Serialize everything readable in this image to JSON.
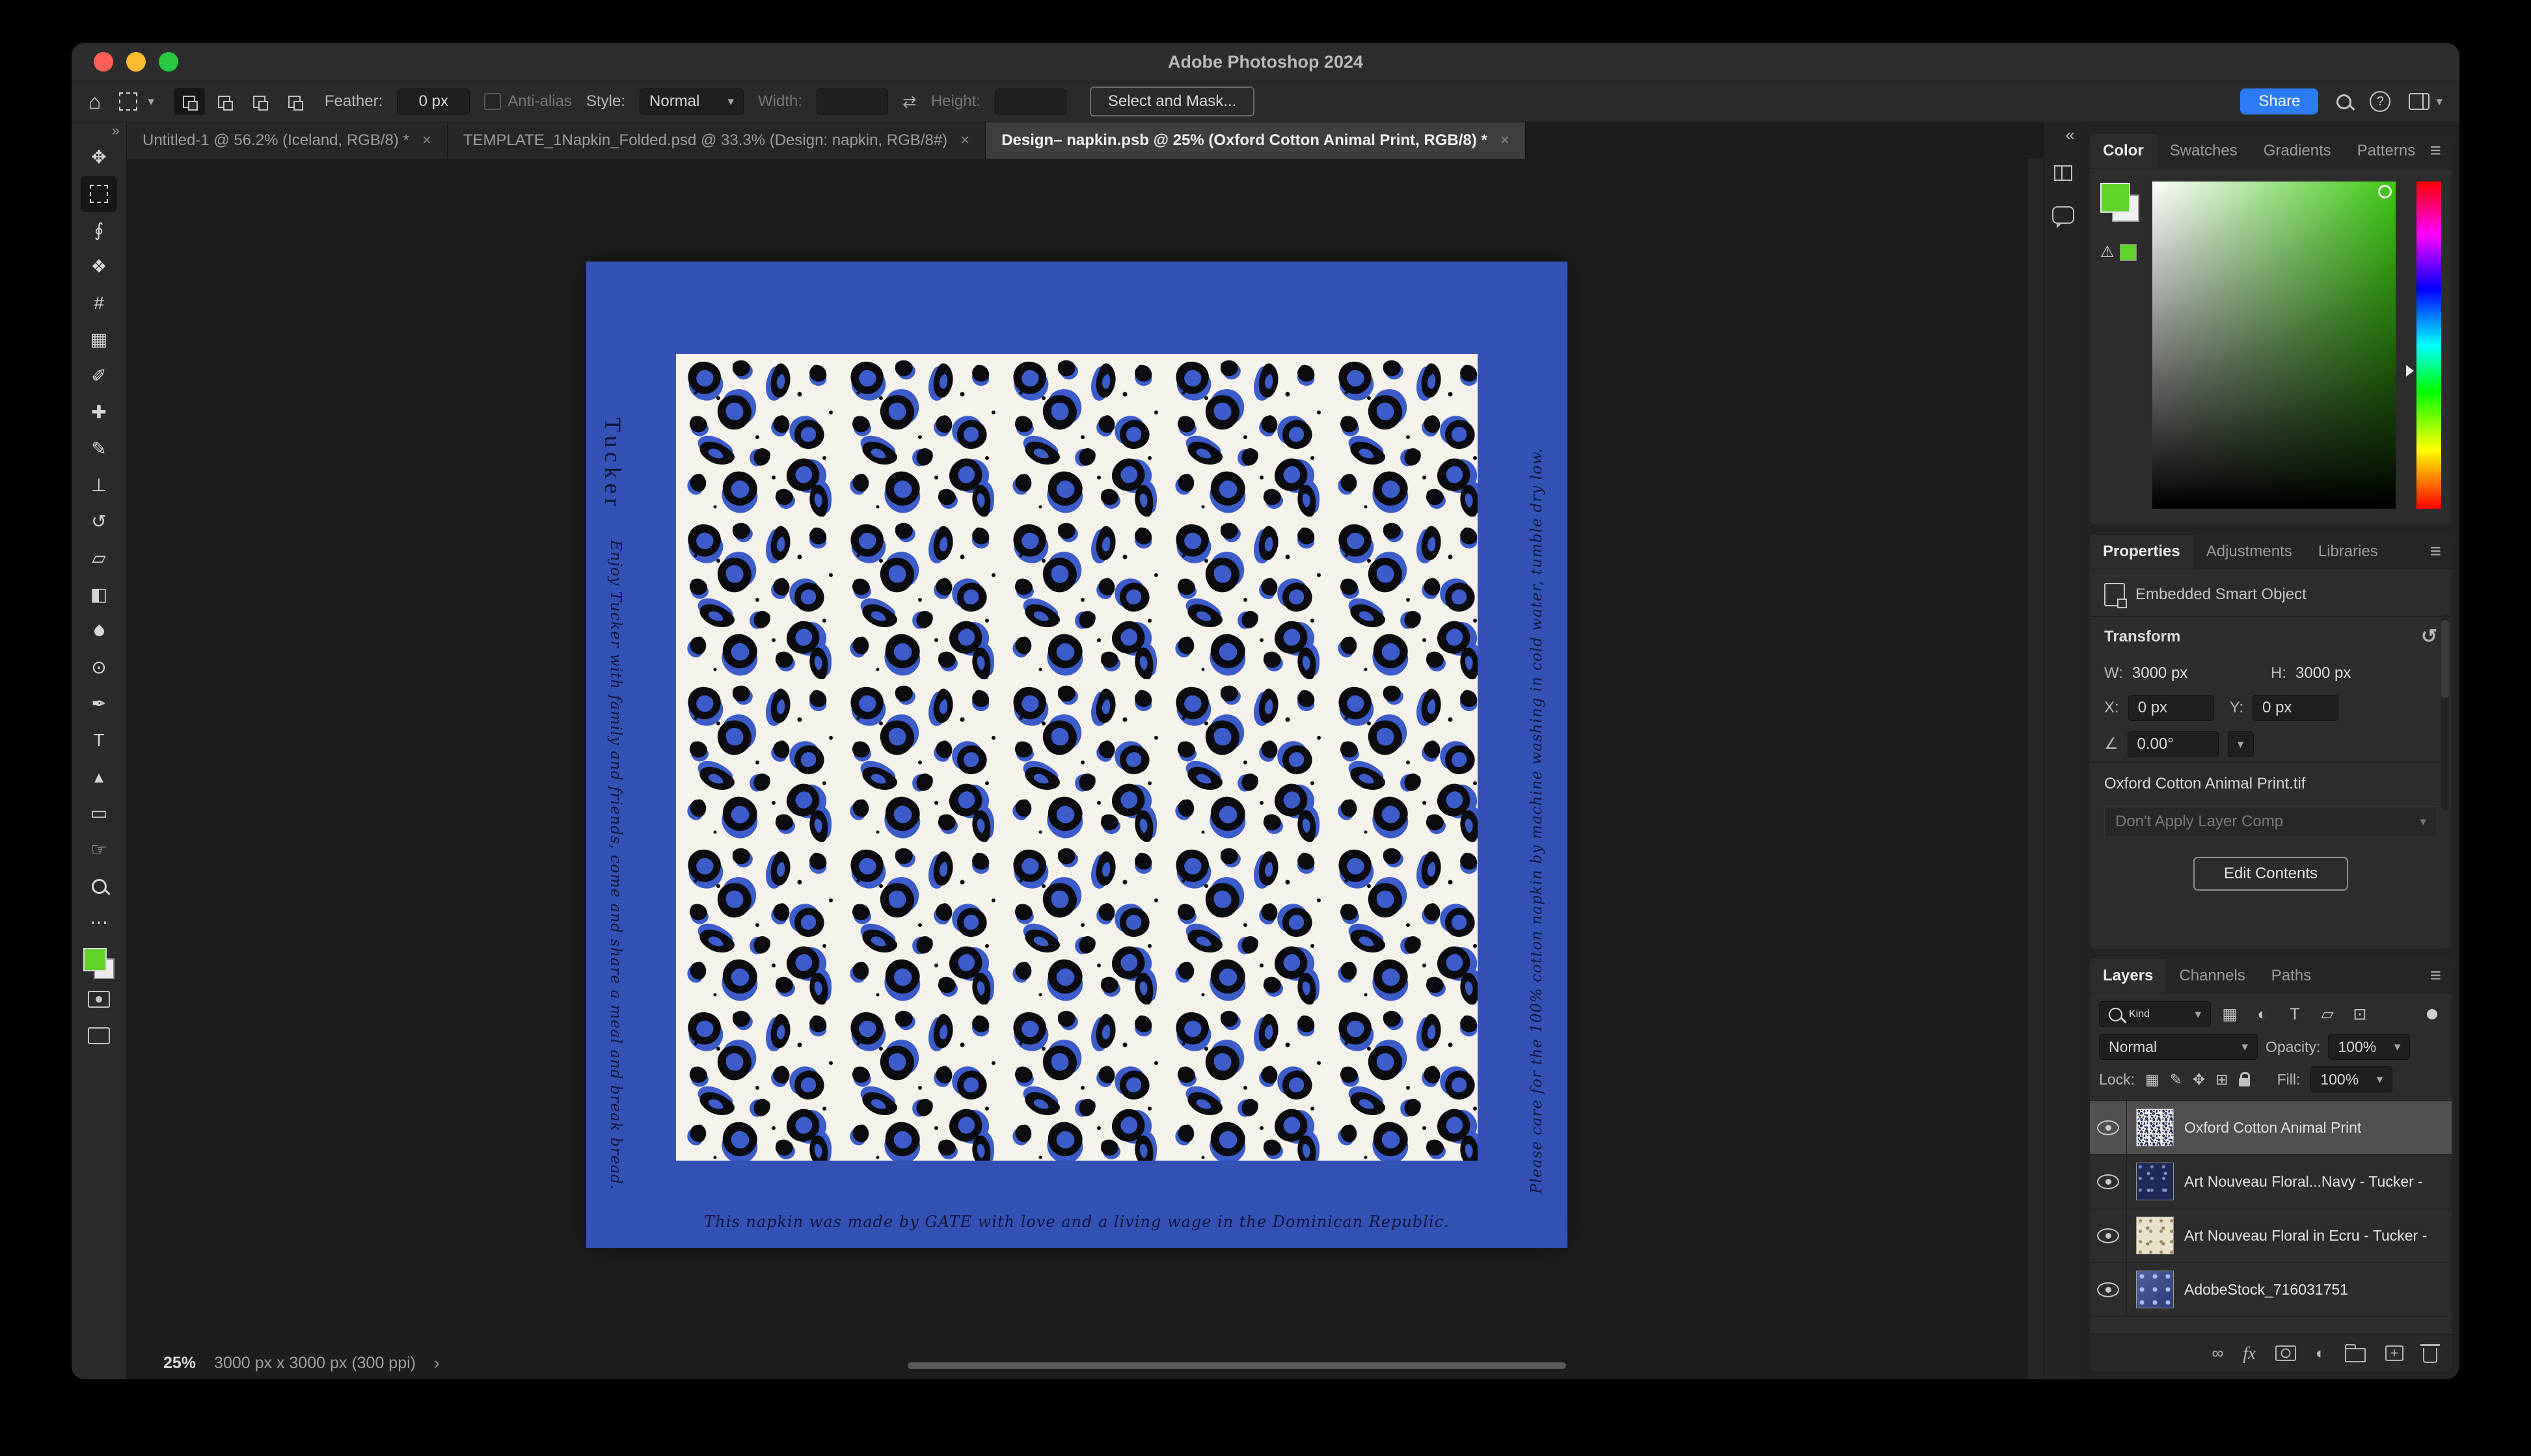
{
  "colors": {
    "share_button": "#2e7bf6",
    "napkin_blue": "#3352b5",
    "pattern_blue": "#3b5cc9",
    "pattern_ink": "#0b0b10",
    "pattern_ground": "#f4f2ea",
    "foreground_green": "#5fd32c",
    "selected_layer_bg": "#505050"
  },
  "icons": {
    "home": "⌂",
    "caret": "▾",
    "close": "×",
    "swap": "⇄",
    "menu": "≡",
    "collapse": "«",
    "chevron": "›",
    "help": "?",
    "warning": "⚠",
    "ellipsis": "⋯",
    "move": "✥",
    "lasso": "∮",
    "object_select": "❖",
    "crop": "#",
    "frame": "▦",
    "eyedropper": "✐",
    "healing": "✚",
    "brush": "✎",
    "stamp": "⊥",
    "history": "↺",
    "eraser": "▱",
    "gradient": "◧",
    "dodge": "⊙",
    "pen": "✒",
    "type": "T",
    "path_select": "▴",
    "shape": "▭",
    "hand": "☞",
    "adjustment": "◐",
    "link": "∞",
    "fx": "fx",
    "reset": "↺",
    "angle": "∠",
    "pixel_filter": "▦",
    "type_filter": "T",
    "shape_filter": "▱",
    "smart_filter": "⊡",
    "lock_transparent": "▦",
    "lock_brush": "✎",
    "lock_move": "✥",
    "lock_artboard": "⊞"
  },
  "titlebar": {
    "title": "Adobe Photoshop 2024"
  },
  "options_bar": {
    "feather_label": "Feather:",
    "feather_value": "0 px",
    "anti_alias_label": "Anti-alias",
    "style_label": "Style:",
    "style_value": "Normal",
    "width_label": "Width:",
    "height_label": "Height:",
    "select_and_mask_label": "Select and Mask...",
    "share_label": "Share"
  },
  "document_tabs": [
    {
      "label": "Untitled-1 @ 56.2% (Iceland, RGB/8) *",
      "active": false
    },
    {
      "label": "TEMPLATE_1Napkin_Folded.psd @ 33.3% (Design: napkin, RGB/8#)",
      "active": false
    },
    {
      "label": "Design– napkin.psb @ 25% (Oxford Cotton Animal Print, RGB/8) *",
      "active": true
    }
  ],
  "canvas": {
    "napkin": {
      "monogram": "Tucker",
      "left_message": "Enjoy Tucker with family and friends, come and share a meal and break bread.",
      "right_message": "Please care for the 100% cotton napkin by machine washing in cold water, tumble dry low.",
      "bottom_message": "This napkin was made by GATE with love and a living wage in the Dominican Republic."
    },
    "status": {
      "zoom": "25%",
      "document_size": "3000 px x 3000 px (300 ppi)"
    }
  },
  "color_panel": {
    "tabs": [
      "Color",
      "Swatches",
      "Gradients",
      "Patterns"
    ]
  },
  "properties_panel": {
    "tabs": [
      "Properties",
      "Adjustments",
      "Libraries"
    ],
    "object_type": "Embedded Smart Object",
    "transform": {
      "heading": "Transform",
      "w_label": "W:",
      "w_value": "3000 px",
      "h_label": "H:",
      "h_value": "3000 px",
      "x_label": "X:",
      "x_value": "0 px",
      "y_label": "Y:",
      "y_value": "0 px",
      "angle_value": "0.00°"
    },
    "source_file": "Oxford Cotton Animal Print.tif",
    "layer_comp": "Don't Apply Layer Comp",
    "edit_contents_label": "Edit Contents"
  },
  "layers_panel": {
    "tabs": [
      "Layers",
      "Channels",
      "Paths"
    ],
    "filter_label": "Kind",
    "blend_mode": "Normal",
    "opacity_label": "Opacity:",
    "opacity_value": "100%",
    "lock_label": "Lock:",
    "fill_label": "Fill:",
    "fill_value": "100%",
    "layers": [
      {
        "name": "Oxford Cotton Animal Print",
        "selected": true
      },
      {
        "name": "Art Nouveau Floral...Navy - Tucker -",
        "selected": false
      },
      {
        "name": "Art Nouveau Floral in Ecru - Tucker -",
        "selected": false
      },
      {
        "name": "AdobeStock_716031751",
        "selected": false
      }
    ]
  }
}
